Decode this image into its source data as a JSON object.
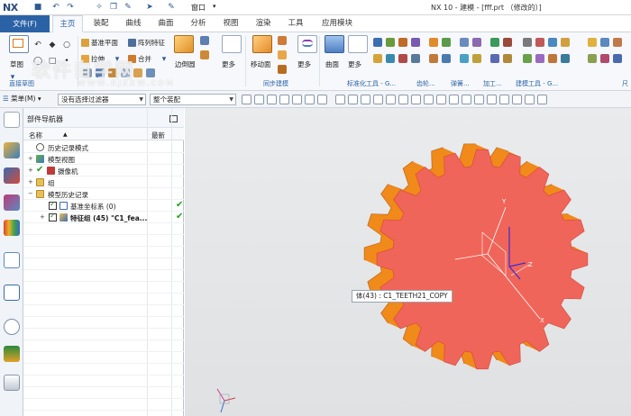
{
  "app": {
    "logo": "NX",
    "window_menu": "窗口",
    "title": "NX 10 - 建模 - [fff.prt （修改的）]"
  },
  "menu": {
    "file": "文件(F)",
    "tabs": [
      "主页",
      "装配",
      "曲线",
      "曲面",
      "分析",
      "视图",
      "渲染",
      "工具",
      "应用模块"
    ],
    "active_tab": "主页"
  },
  "ribbon": {
    "sketch": "草图",
    "datum_plane": "基准平面",
    "array_feature": "阵列特征",
    "extrude": "拉伸",
    "unite": "合并",
    "edge_blend": "边倒圆",
    "more1": "更多",
    "move_face": "移动面",
    "more2": "更多",
    "surface": "曲面",
    "more3": "更多",
    "group_direct_sketch": "直接草图",
    "group_sync_modeling": "同步建模",
    "group_standard_tools": "标准化工具 - G...",
    "group_motion": "齿轮...",
    "group_spring": "弹簧...",
    "group_machining": "加工...",
    "group_model_tools": "建模工具 - G...",
    "group_tail": "尺"
  },
  "selection_bar": {
    "menu": "菜单(M)",
    "filter": "没有选择过滤器",
    "scope": "整个装配"
  },
  "navigator": {
    "title": "部件导航器",
    "col_name": "名称",
    "col_latest": "最新",
    "rows": [
      {
        "label": "历史记录模式",
        "level": 0,
        "checked": false,
        "latest": false
      },
      {
        "label": "模型视图",
        "level": 0,
        "checked": false,
        "latest": false
      },
      {
        "label": "摄像机",
        "level": 0,
        "checked": true,
        "latest": false
      },
      {
        "label": "组",
        "level": 0,
        "checked": false,
        "latest": false
      },
      {
        "label": "模型历史记录",
        "level": 0,
        "checked": false,
        "latest": false
      },
      {
        "label": "基准坐标系 (0)",
        "level": 1,
        "checked": true,
        "latest": true
      },
      {
        "label": "特征组 (45) \"C1_fea...",
        "level": 1,
        "checked": true,
        "latest": true
      }
    ]
  },
  "viewport": {
    "tooltip": "体(43) : C1_TEETH21_COPY",
    "axis_y": "Y",
    "axis_z": "Z",
    "axis_x": "X",
    "gear_face_color": "#f0655a",
    "gear_side_color": "#f08a1a",
    "gear_teeth": 20
  },
  "watermark": {
    "text": "软件自学网",
    "url": "WWW.RJZXW.COM"
  }
}
